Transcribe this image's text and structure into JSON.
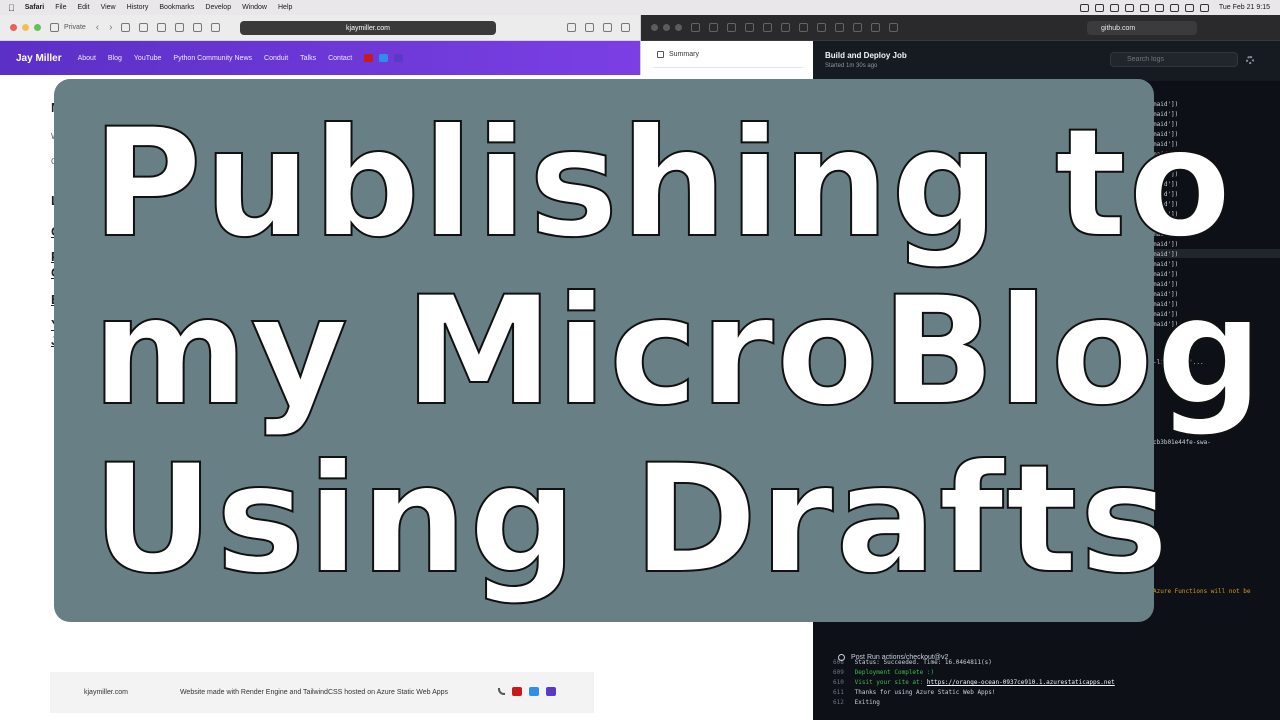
{
  "menubar": {
    "app": "Safari",
    "items": [
      "File",
      "Edit",
      "View",
      "History",
      "Bookmarks",
      "Develop",
      "Window",
      "Help"
    ],
    "clock": "Tue Feb 21 9:15"
  },
  "left_browser": {
    "mode_label": "Private",
    "url": "kjaymiller.com",
    "site": {
      "brand": "Jay Miller",
      "nav": [
        "About",
        "Blog",
        "YouTube",
        "Python Community News",
        "Conduit",
        "Talks",
        "Contact"
      ],
      "social_icons": [
        "youtube-icon",
        "twitter-icon",
        "linkedin-icon"
      ]
    },
    "body_fragments": {
      "f1": "M",
      "f2": "W",
      "f3": "C",
      "f4": "L",
      "f5": "C",
      "f6": "P",
      "f7": "C",
      "f8": "E",
      "f9": "Y",
      "f10": "J"
    },
    "footer": {
      "domain": "kjaymiller.com",
      "text": "Website made with Render Engine and TailwindCSS hosted on Azure Static Web Apps",
      "icons": [
        "rss-icon",
        "youtube-icon",
        "twitter-icon",
        "linkedin-icon"
      ]
    }
  },
  "right_browser": {
    "url": "github.com",
    "sidebar": {
      "summary_label": "Summary"
    },
    "job": {
      "title": "Build and Deploy Job",
      "subtitle": "Started 1m 30s ago",
      "search_placeholder": "Search logs"
    },
    "log_fragment": "maid'])",
    "log_fragment_2": "-linux-x64'...",
    "log_fragment_3": "cb3b01e44fe-swa-",
    "warning_fragment": "Azure Functions will not be",
    "log_lines": [
      {
        "num": "608",
        "text": "Status: Succeeded. Time: 16.0464811(s)"
      },
      {
        "num": "609",
        "text": "Deployment Complete :)"
      },
      {
        "num": "610",
        "prefix": "Visit your site at: ",
        "url": "https://orange-ocean-0937ce910.1.azurestaticapps.net"
      },
      {
        "num": "611",
        "text": "Thanks for using Azure Static Web Apps!"
      },
      {
        "num": "612",
        "text": "Exiting"
      }
    ],
    "post_run": "Post Run actions/checkout@v2"
  },
  "title_card": {
    "line1": "Publishing to",
    "line2": "my MicroBlog",
    "line3": "Using Drafts",
    "background": "#688085"
  }
}
